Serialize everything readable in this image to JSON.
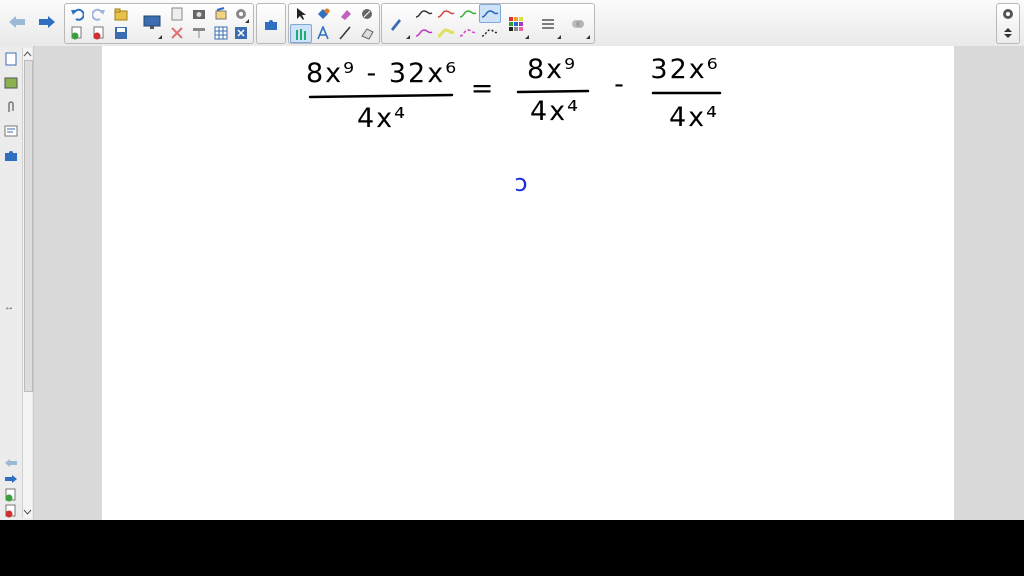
{
  "toolbar": {
    "tooltip_texts": {
      "back": "Back",
      "forward": "Forward",
      "undo": "Undo",
      "redo": "Redo",
      "insert_page": "Insert page",
      "delete_page": "Delete page",
      "open": "Open",
      "save": "Save",
      "display": "Display",
      "paste": "Paste",
      "delete": "Delete",
      "screen": "Screen shade",
      "capture": "Capture",
      "crop": "Crop",
      "table": "Table",
      "toggle": "Toggle",
      "extension": "Extension",
      "select": "Select",
      "fill": "Fill",
      "eraser": "Eraser",
      "magic": "Magic pen",
      "pens": "Pens",
      "text": "Text",
      "line": "Line",
      "shape": "Shape",
      "pen": "Pen",
      "colors": "Colors",
      "properties": "Properties",
      "more": "More",
      "settings": "Settings",
      "toolbar_position": "Toolbar position"
    },
    "pen_colors": [
      "#333333",
      "#d04040",
      "#30b030",
      "#2060c0",
      "#c030c0",
      "#e0e060",
      "#d040d0",
      "#222222"
    ],
    "accent": "#3a6fb0"
  },
  "sidebar": {
    "resize_glyph": "↔"
  },
  "canvas": {
    "equation": {
      "lhs_numerator": "8x⁹ - 32x⁶",
      "lhs_denominator": "4x⁴",
      "equals": "=",
      "term1_numerator": "8x⁹",
      "term1_denominator": "4x⁴",
      "minus": "-",
      "term2_numerator": "32x⁶",
      "term2_denominator": "4x⁴"
    },
    "stray_mark": "ↄ",
    "ink_color": "#000000",
    "accent_ink_color": "#1a2ed8"
  }
}
